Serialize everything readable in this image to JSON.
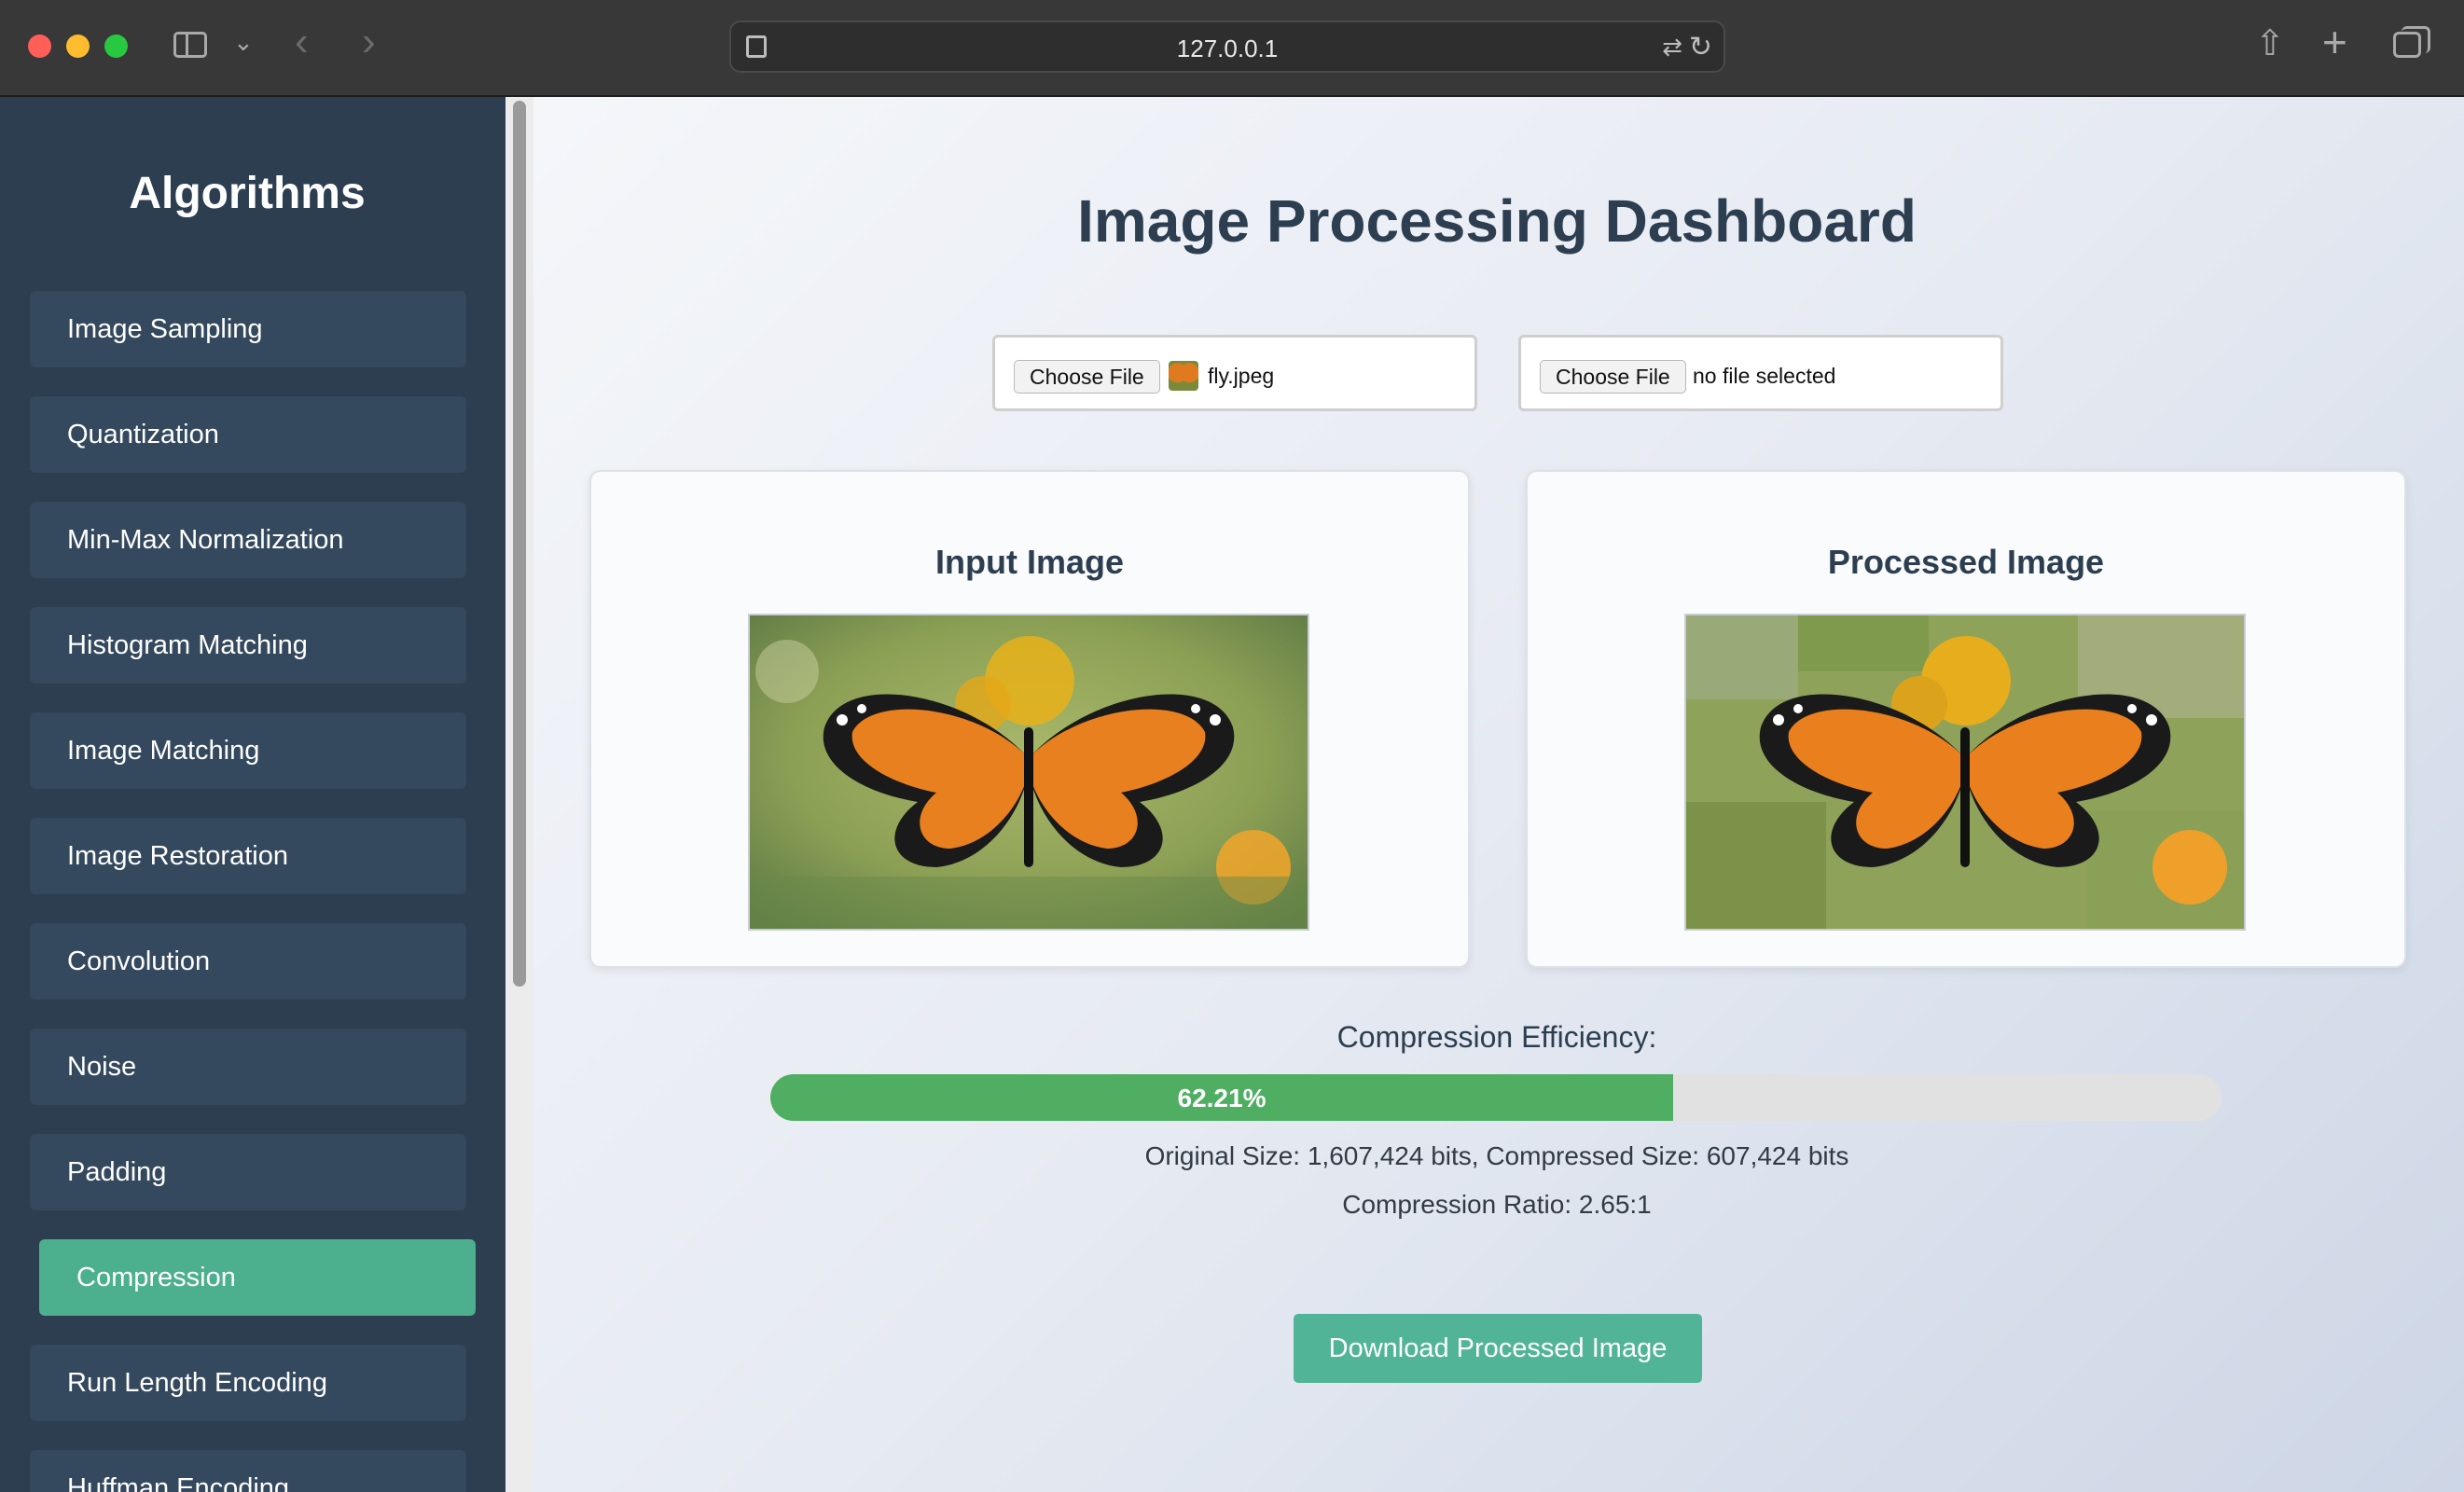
{
  "browser": {
    "url": "127.0.0.1"
  },
  "sidebar": {
    "title": "Algorithms",
    "items": [
      {
        "label": "Image Sampling",
        "active": false
      },
      {
        "label": "Quantization",
        "active": false
      },
      {
        "label": "Min-Max Normalization",
        "active": false
      },
      {
        "label": "Histogram Matching",
        "active": false
      },
      {
        "label": "Image Matching",
        "active": false
      },
      {
        "label": "Image Restoration",
        "active": false
      },
      {
        "label": "Convolution",
        "active": false
      },
      {
        "label": "Noise",
        "active": false
      },
      {
        "label": "Padding",
        "active": false
      },
      {
        "label": "Compression",
        "active": true
      },
      {
        "label": "Run Length Encoding",
        "active": false
      },
      {
        "label": "Huffman Encoding",
        "active": false
      }
    ],
    "active_color": "#4caf8e"
  },
  "main": {
    "title": "Image Processing Dashboard",
    "file_inputs": [
      {
        "button_label": "Choose File",
        "file_name": "fly.jpeg"
      },
      {
        "button_label": "Choose File",
        "file_name": "no file selected"
      }
    ],
    "cards": [
      {
        "title": "Input Image"
      },
      {
        "title": "Processed Image"
      }
    ],
    "compression": {
      "label": "Compression Efficiency:",
      "efficiency_percent": 62.21,
      "efficiency_text": "62.21%",
      "sizes_text": "Original Size: 1,607,424 bits, Compressed Size: 607,424 bits",
      "ratio_text": "Compression Ratio: 2.65:1"
    },
    "download_label": "Download Processed Image"
  }
}
